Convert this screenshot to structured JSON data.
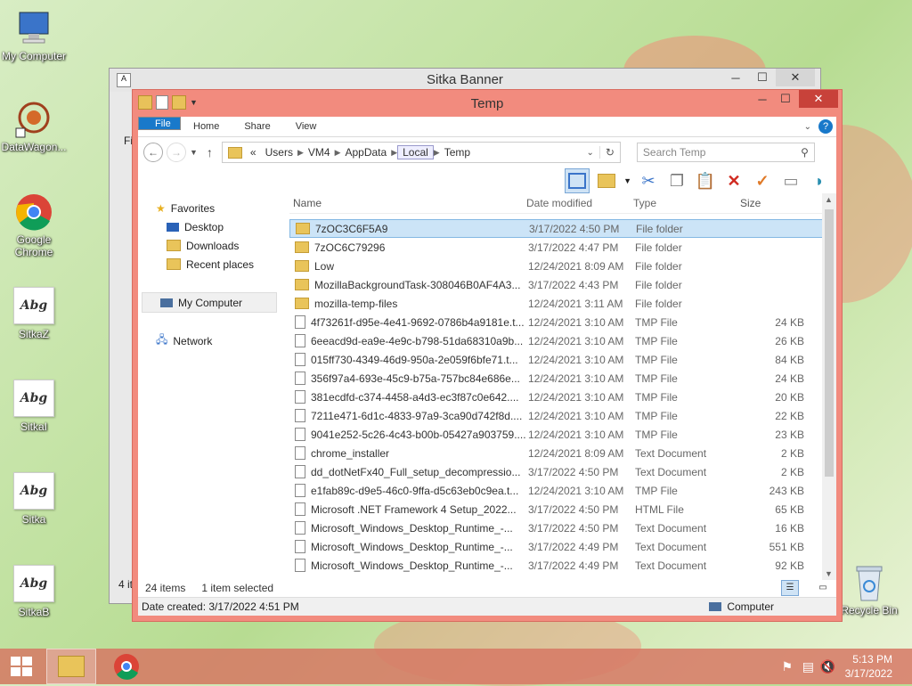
{
  "desktop": {
    "icons": [
      {
        "label": "My Computer",
        "icon": "computer-icon"
      },
      {
        "label": "DataWagon...",
        "icon": "datawagon-icon"
      },
      {
        "label": "Google Chrome",
        "icon": "chrome-icon"
      },
      {
        "label": "SitkaZ",
        "icon": "font-icon",
        "glyph": "Abg"
      },
      {
        "label": "SitkaI",
        "icon": "font-icon",
        "glyph": "Abg"
      },
      {
        "label": "Sitka",
        "icon": "font-icon",
        "glyph": "Abg"
      },
      {
        "label": "SitkaB",
        "icon": "font-icon",
        "glyph": "Abg"
      },
      {
        "label": "Recycle Bin",
        "icon": "recycle-bin-icon"
      }
    ]
  },
  "back_window": {
    "title": "Sitka Banner",
    "partial_text": "Fi",
    "status_partial": "4 it"
  },
  "window": {
    "title": "Temp",
    "ribbon_tabs": [
      "File",
      "Home",
      "Share",
      "View"
    ],
    "address": {
      "prefix": "«",
      "crumbs": [
        "Users",
        "VM4",
        "AppData",
        "Local",
        "Temp"
      ]
    },
    "search_placeholder": "Search Temp",
    "columns": {
      "name": "Name",
      "date": "Date modified",
      "type": "Type",
      "size": "Size"
    },
    "nav": {
      "favorites": "Favorites",
      "desktop": "Desktop",
      "downloads": "Downloads",
      "recent": "Recent places",
      "computer": "My Computer",
      "network": "Network"
    },
    "files": [
      {
        "name": "7zOC3C6F5A9",
        "date": "3/17/2022 4:50 PM",
        "type": "File folder",
        "size": "",
        "kind": "folder"
      },
      {
        "name": "7zOC6C79296",
        "date": "3/17/2022 4:47 PM",
        "type": "File folder",
        "size": "",
        "kind": "folder"
      },
      {
        "name": "Low",
        "date": "12/24/2021 8:09 AM",
        "type": "File folder",
        "size": "",
        "kind": "folder"
      },
      {
        "name": "MozillaBackgroundTask-308046B0AF4A3...",
        "date": "3/17/2022 4:43 PM",
        "type": "File folder",
        "size": "",
        "kind": "folder"
      },
      {
        "name": "mozilla-temp-files",
        "date": "12/24/2021 3:11 AM",
        "type": "File folder",
        "size": "",
        "kind": "folder"
      },
      {
        "name": "4f73261f-d95e-4e41-9692-0786b4a9181e.t...",
        "date": "12/24/2021 3:10 AM",
        "type": "TMP File",
        "size": "24 KB",
        "kind": "file"
      },
      {
        "name": "6eeacd9d-ea9e-4e9c-b798-51da68310a9b...",
        "date": "12/24/2021 3:10 AM",
        "type": "TMP File",
        "size": "26 KB",
        "kind": "file"
      },
      {
        "name": "015ff730-4349-46d9-950a-2e059f6bfe71.t...",
        "date": "12/24/2021 3:10 AM",
        "type": "TMP File",
        "size": "84 KB",
        "kind": "file"
      },
      {
        "name": "356f97a4-693e-45c9-b75a-757bc84e686e...",
        "date": "12/24/2021 3:10 AM",
        "type": "TMP File",
        "size": "24 KB",
        "kind": "file"
      },
      {
        "name": "381ecdfd-c374-4458-a4d3-ec3f87c0e642....",
        "date": "12/24/2021 3:10 AM",
        "type": "TMP File",
        "size": "20 KB",
        "kind": "file"
      },
      {
        "name": "7211e471-6d1c-4833-97a9-3ca90d742f8d....",
        "date": "12/24/2021 3:10 AM",
        "type": "TMP File",
        "size": "22 KB",
        "kind": "file"
      },
      {
        "name": "9041e252-5c26-4c43-b00b-05427a903759....",
        "date": "12/24/2021 3:10 AM",
        "type": "TMP File",
        "size": "23 KB",
        "kind": "file"
      },
      {
        "name": "chrome_installer",
        "date": "12/24/2021 8:09 AM",
        "type": "Text Document",
        "size": "2 KB",
        "kind": "file"
      },
      {
        "name": "dd_dotNetFx40_Full_setup_decompressio...",
        "date": "3/17/2022 4:50 PM",
        "type": "Text Document",
        "size": "2 KB",
        "kind": "file"
      },
      {
        "name": "e1fab89c-d9e5-46c0-9ffa-d5c63eb0c9ea.t...",
        "date": "12/24/2021 3:10 AM",
        "type": "TMP File",
        "size": "243 KB",
        "kind": "file"
      },
      {
        "name": "Microsoft .NET Framework 4 Setup_2022...",
        "date": "3/17/2022 4:50 PM",
        "type": "HTML File",
        "size": "65 KB",
        "kind": "file"
      },
      {
        "name": "Microsoft_Windows_Desktop_Runtime_-...",
        "date": "3/17/2022 4:50 PM",
        "type": "Text Document",
        "size": "16 KB",
        "kind": "file"
      },
      {
        "name": "Microsoft_Windows_Desktop_Runtime_-...",
        "date": "3/17/2022 4:49 PM",
        "type": "Text Document",
        "size": "551 KB",
        "kind": "file"
      },
      {
        "name": "Microsoft_Windows_Desktop_Runtime_-...",
        "date": "3/17/2022 4:49 PM",
        "type": "Text Document",
        "size": "92 KB",
        "kind": "file"
      }
    ],
    "selected_index": 0,
    "status": {
      "count": "24 items",
      "selected": "1 item selected"
    },
    "details": {
      "date_created": "Date created: 3/17/2022 4:51 PM",
      "location": "Computer"
    }
  },
  "taskbar": {
    "time": "5:13 PM",
    "date": "3/17/2022"
  },
  "colors": {
    "window_frame": "#f28b7e",
    "selection": "#cce4f7",
    "file_tab": "#1979ca",
    "close": "#c8423a"
  }
}
